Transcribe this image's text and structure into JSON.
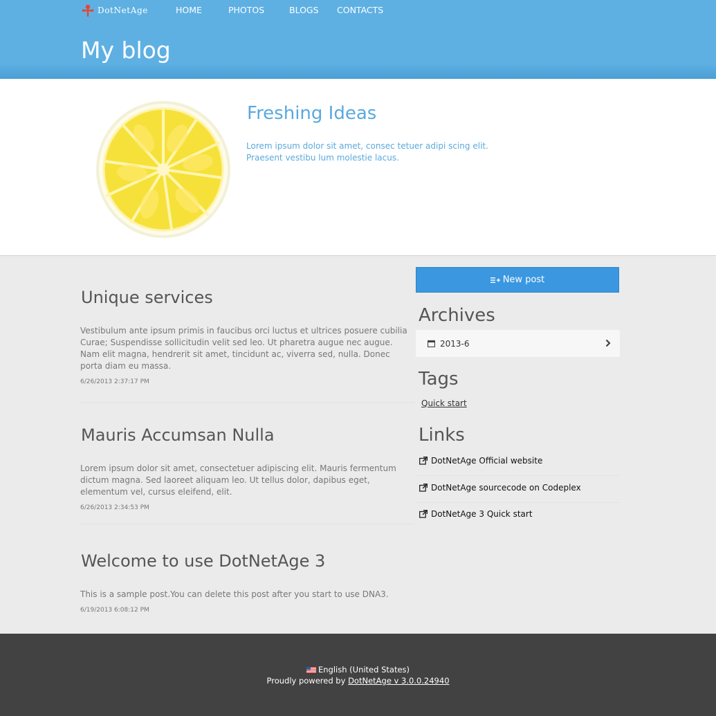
{
  "header": {
    "logo_text": "DotNetAge",
    "nav": [
      "HOME",
      "PHOTOS",
      "BLOGS",
      "CONTACTS"
    ],
    "page_title": "My blog",
    "color": "#5eb0e3"
  },
  "hero": {
    "title": "Freshing Ideas",
    "text_line1": "Lorem ipsum dolor sit amet, consec tetuer adipi scing elit.",
    "text_line2": "Praesent vestibu lum molestie lacus.",
    "image_icon": "lemon-slice-image"
  },
  "posts": [
    {
      "title": "Unique services",
      "body": "Vestibulum ante ipsum primis in faucibus orci luctus et ultrices posuere cubilia Curae; Suspendisse sollicitudin velit sed leo. Ut pharetra augue nec augue. Nam elit magna, hendrerit sit amet, tincidunt ac, viverra sed, nulla. Donec porta diam eu massa.",
      "date": "6/26/2013 2:37:17 PM"
    },
    {
      "title": "Mauris Accumsan Nulla",
      "body": "Lorem ipsum dolor sit amet, consectetuer adipiscing elit. Mauris fermentum dictum magna. Sed laoreet aliquam leo. Ut tellus dolor, dapibus eget, elementum vel, cursus eleifend, elit.",
      "date": "6/26/2013 2:34:53 PM"
    },
    {
      "title": "Welcome to use DotNetAge 3",
      "body": "This is a sample post.You can delete this post after you start to use DNA3.",
      "date": "6/19/2013 6:08:12 PM"
    }
  ],
  "sidebar": {
    "new_post_label": "New post",
    "archives_heading": "Archives",
    "archive_item": "2013-6",
    "tags_heading": "Tags",
    "tag": "Quick start",
    "links_heading": "Links",
    "links": [
      "DotNetAge Official website",
      "DotNetAge sourcecode on Codeplex",
      "DotNetAge 3 Quick start"
    ],
    "accent_color": "#3a97e0"
  },
  "footer": {
    "language": "English (United States)",
    "powered_prefix": "Proudly powered by ",
    "powered_link": "DotNetAge v 3.0.0.24940",
    "color": "#424242"
  }
}
